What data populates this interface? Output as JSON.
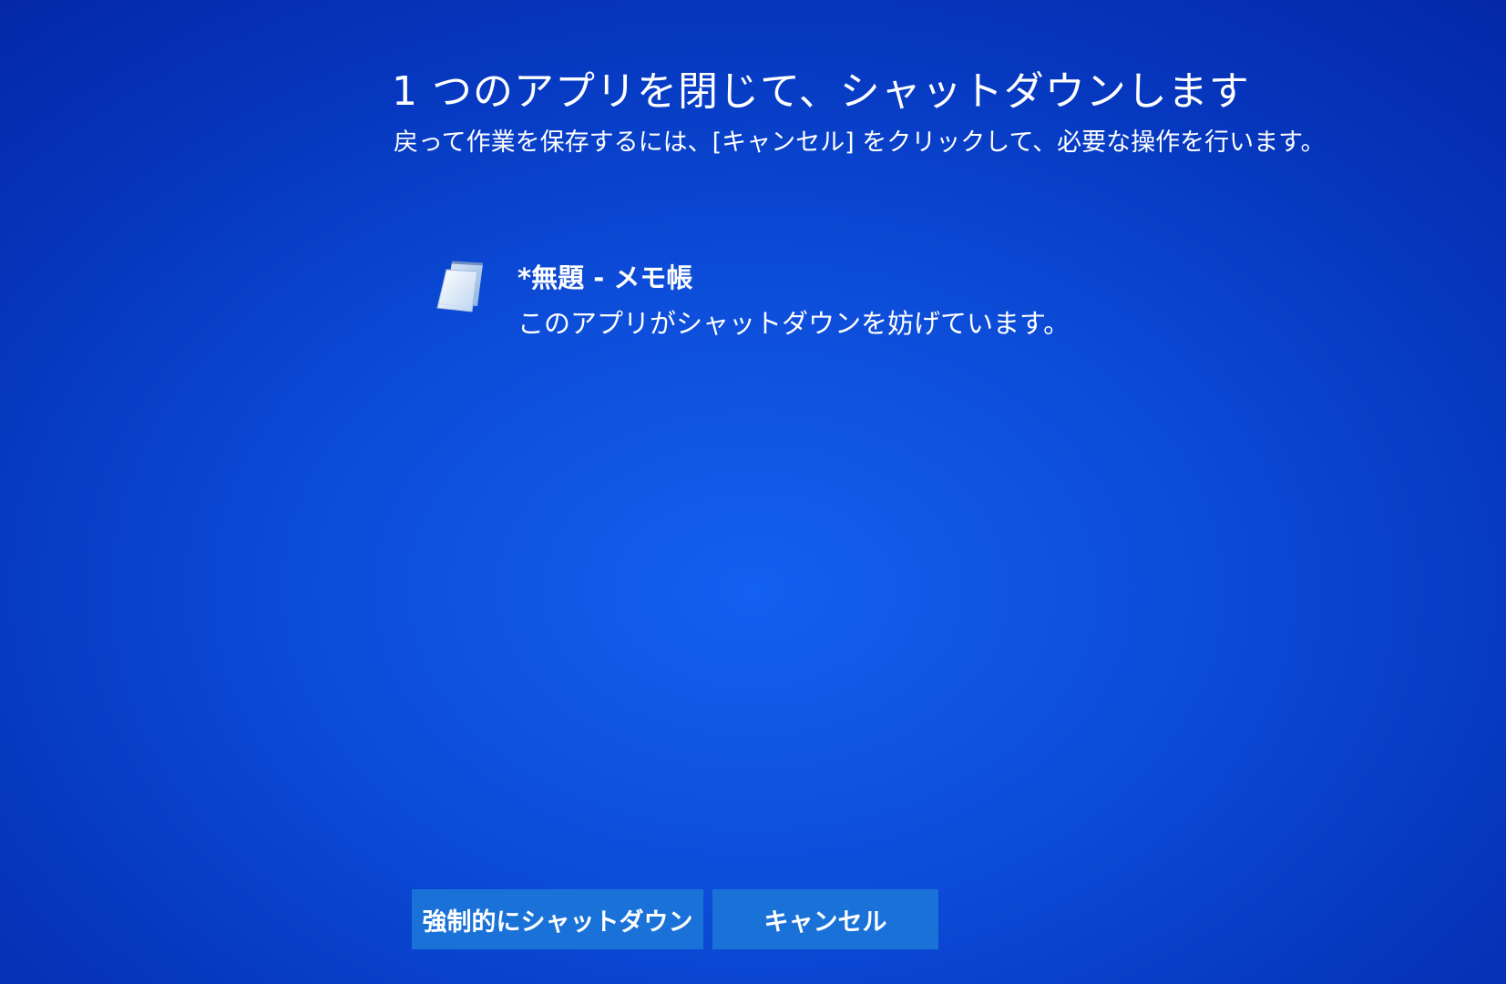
{
  "header": {
    "title": "1 つのアプリを閉じて、シャットダウンします",
    "subtitle": "戻って作業を保存するには、[キャンセル] をクリックして、必要な操作を行います。"
  },
  "blocking_apps": [
    {
      "name": "*無題 - メモ帳",
      "status": "このアプリがシャットダウンを妨げています。",
      "icon": "notepad-icon"
    }
  ],
  "buttons": {
    "force_shutdown_label": "強制的にシャットダウン",
    "cancel_label": "キャンセル"
  },
  "colors": {
    "background": "#0c4cd8",
    "button": "#1a72d8",
    "text": "#ffffff"
  }
}
